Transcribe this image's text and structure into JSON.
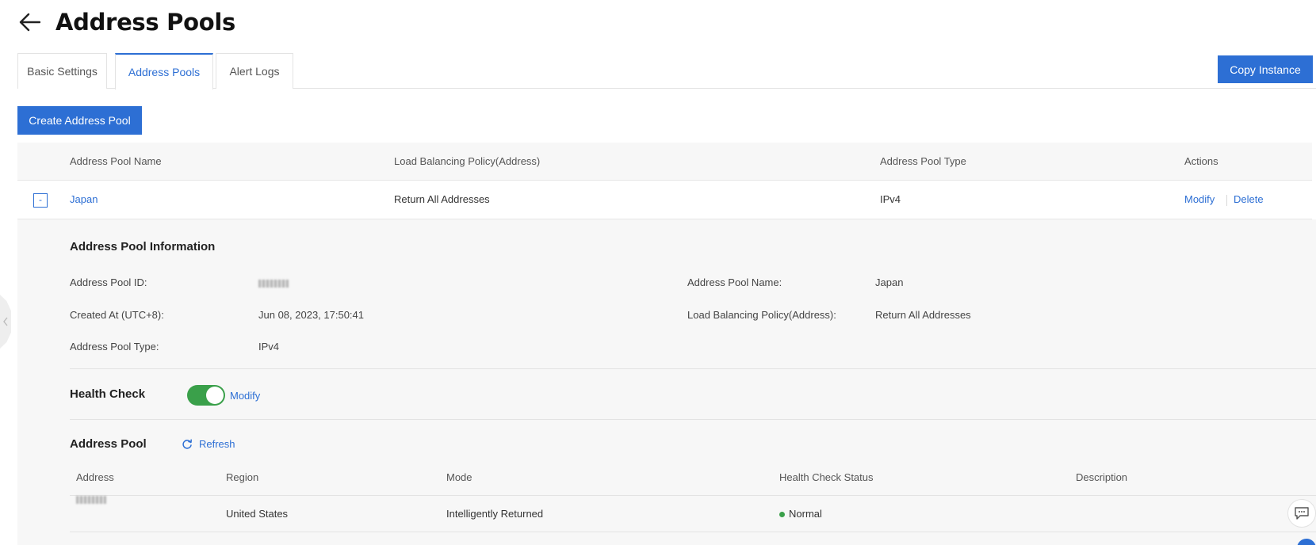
{
  "header": {
    "title": "Address Pools",
    "back_icon": "arrow-left-icon"
  },
  "tabs": [
    {
      "label": "Basic Settings",
      "active": false
    },
    {
      "label": "Address Pools",
      "active": true
    },
    {
      "label": "Alert Logs",
      "active": false
    }
  ],
  "toolbar": {
    "copy_label": "Copy Instance",
    "create_label": "Create Address Pool"
  },
  "table": {
    "columns": [
      "Address Pool Name",
      "Load Balancing Policy(Address)",
      "Address Pool Type",
      "Actions"
    ],
    "row": {
      "expand_symbol": "-",
      "name": "Japan",
      "policy": "Return All Addresses",
      "type": "IPv4",
      "actions": {
        "modify": "Modify",
        "delete": "Delete"
      }
    }
  },
  "detail": {
    "info_title": "Address Pool Information",
    "fields": {
      "id_label": "Address Pool ID:",
      "name_label": "Address Pool Name:",
      "name_value": "Japan",
      "created_label": "Created At (UTC+8):",
      "created_value": "Jun 08, 2023, 17:50:41",
      "policy_label": "Load Balancing Policy(Address):",
      "policy_value": "Return All Addresses",
      "type_label": "Address Pool Type:",
      "type_value": "IPv4"
    },
    "health_check": {
      "title": "Health Check",
      "enabled": true,
      "modify_label": "Modify"
    },
    "address_pool": {
      "title": "Address Pool",
      "refresh_label": "Refresh",
      "columns": [
        "Address",
        "Region",
        "Mode",
        "Health Check Status",
        "Description"
      ],
      "rows": [
        {
          "region": "United States",
          "mode": "Intelligently Returned",
          "status": "Normal",
          "description": ""
        }
      ]
    }
  },
  "colors": {
    "primary": "#2d6fd4",
    "success": "#3aa04a",
    "panel_bg": "#f7f7f7"
  }
}
